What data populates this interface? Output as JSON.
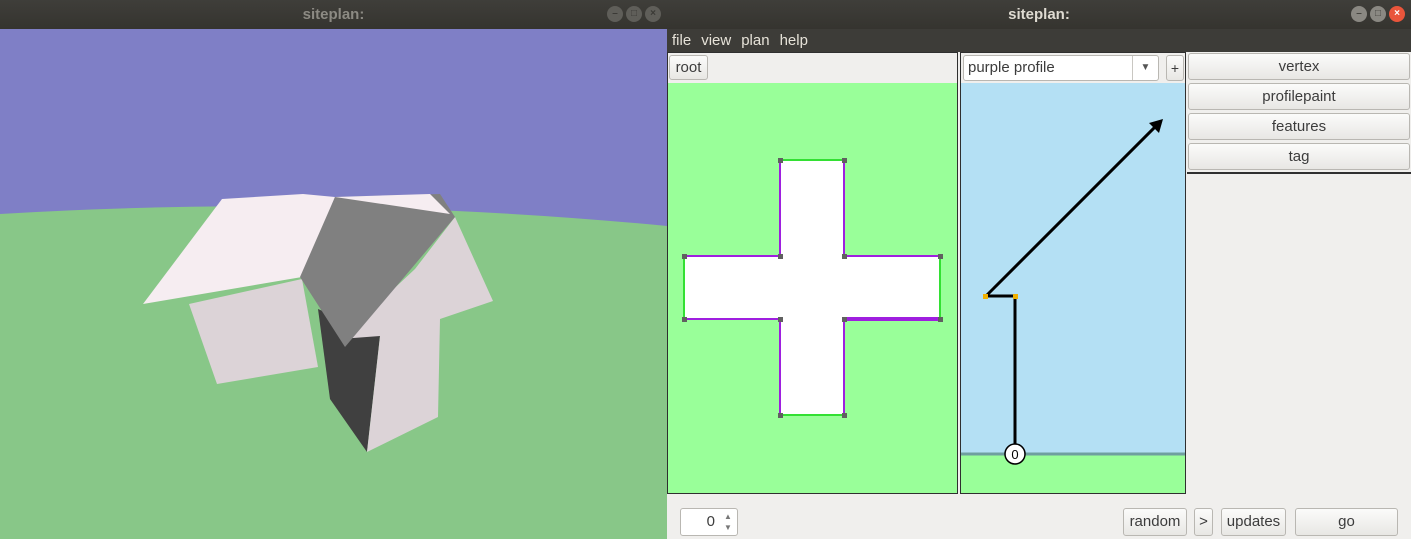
{
  "viewer_window": {
    "title": "siteplan:",
    "colors": {
      "sky": "#7f7fc6",
      "ground": "#88c788",
      "roof_light": "#f6edf1",
      "wall_light": "#dcd3d7",
      "roof_dark": "#808080",
      "wall_dark": "#404040"
    }
  },
  "editor_window": {
    "title": "siteplan:",
    "menu": [
      "file",
      "view",
      "plan",
      "help"
    ],
    "plan_panel": {
      "root_button": "root",
      "colors": {
        "background": "#99ff99",
        "building": "#ffffff",
        "edge_purple": "#9f1fdf",
        "edge_green": "#33e033",
        "vertex": "#606060"
      }
    },
    "profile_panel": {
      "selected_profile": "purple profile",
      "add_button": "+",
      "origin_label": "0",
      "colors": {
        "sky": "#b4e0f4",
        "ground": "#99ff99",
        "ground_line": "#6f9f9f",
        "vertex": "#f0b000"
      }
    },
    "tools": [
      "vertex",
      "profilepaint",
      "features",
      "tag"
    ],
    "bottom_bar": {
      "counter_value": "0",
      "random_button": "random",
      "next_button": ">",
      "updates_button": "updates",
      "go_button": "go"
    }
  }
}
